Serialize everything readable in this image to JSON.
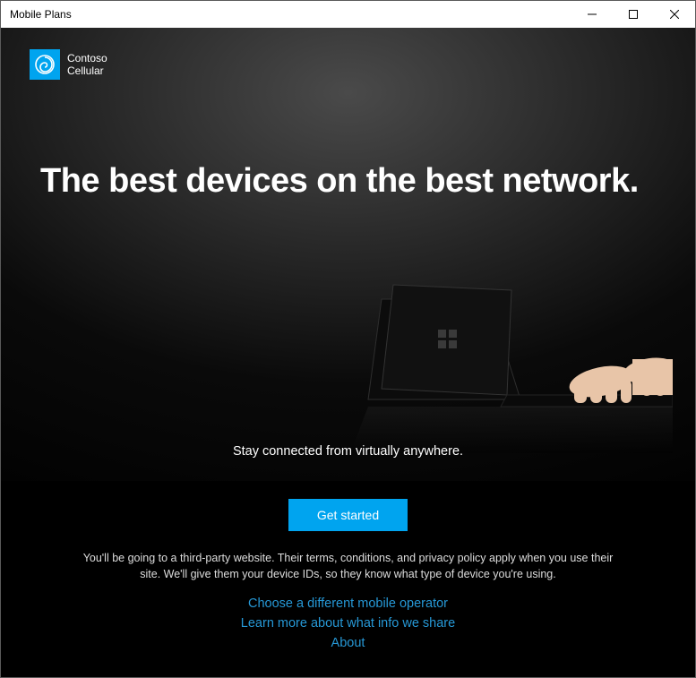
{
  "window": {
    "title": "Mobile Plans"
  },
  "brand": {
    "name_line1": "Contoso",
    "name_line2": "Cellular"
  },
  "hero": {
    "headline": "The best devices on the best network.",
    "subheadline": "Stay connected from virtually anywhere."
  },
  "cta": {
    "label": "Get started"
  },
  "disclaimer": "You'll be going to a third-party website. Their terms, conditions, and privacy policy apply when you use their site. We'll give them your device IDs, so they know what type of device you're using.",
  "links": {
    "choose_operator": "Choose a different mobile operator",
    "learn_more": "Learn more about what info we share",
    "about": "About"
  },
  "colors": {
    "accent": "#00a4ef",
    "link": "#2698d6"
  }
}
